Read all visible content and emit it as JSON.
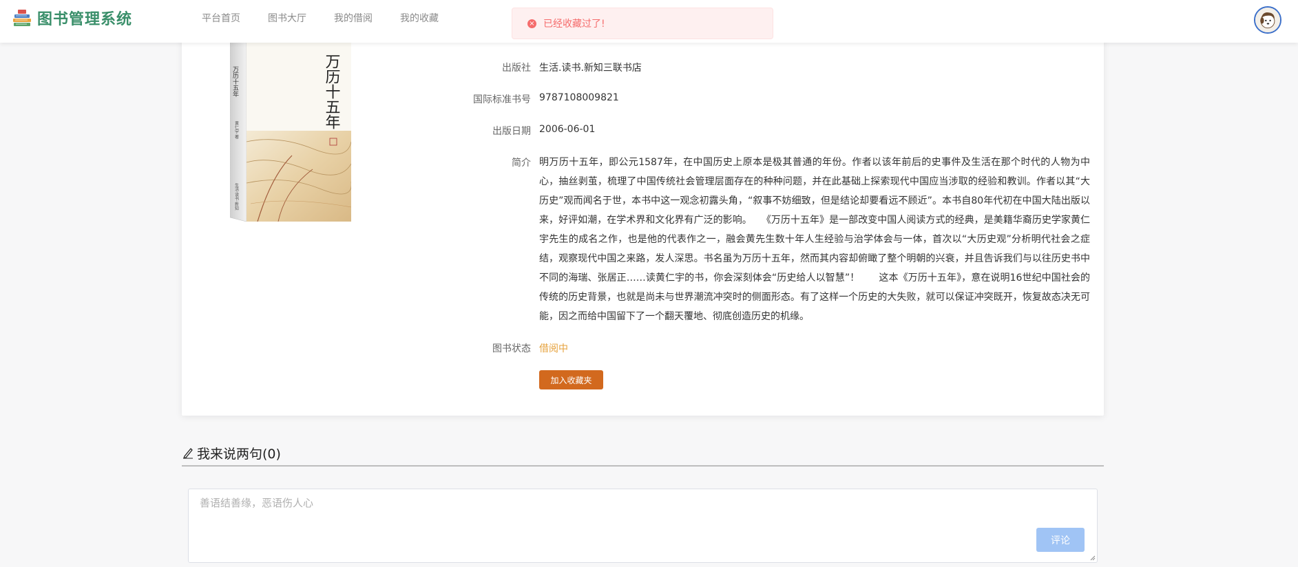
{
  "app": {
    "title": "图书管理系统"
  },
  "nav": {
    "items": [
      {
        "label": "平台首页"
      },
      {
        "label": "图书大厅"
      },
      {
        "label": "我的借阅"
      },
      {
        "label": "我的收藏"
      }
    ]
  },
  "toast": {
    "message": "已经收藏过了!",
    "icon": "error-circle-icon",
    "color": "#f56c6c"
  },
  "book": {
    "cover_title": "万历十五年",
    "fields": [
      {
        "label": "出版社",
        "value": "生活.读书.新知三联书店"
      },
      {
        "label": "国际标准书号",
        "value": "9787108009821"
      },
      {
        "label": "出版日期",
        "value": "2006-06-01"
      }
    ],
    "intro_label": "简介",
    "intro": "明万历十五年，即公元1587年，在中国历史上原本是极其普通的年份。作者以该年前后的史事件及生活在那个时代的人物为中心，抽丝剥茧，梳理了中国传统社会管理层面存在的种种问题，并在此基础上探索现代中国应当涉取的经验和教训。作者以其“大历史”观而闻名于世，本书中这一观念初露头角，“叙事不妨细致，但是结论却要看远不顾近”。本书自80年代初在中国大陆出版以来，好评如潮，在学术界和文化界有广泛的影响。　　《万历十五年》是一部改变中国人阅读方式的经典，是美籍华裔历史学家黄仁宇先生的成名之作，也是他的代表作之一，融会黄先生数十年人生经验与治学体会与一体，首次以“大历史观”分析明代社会之症结，观察现代中国之来路，发人深思。书名虽为万历十五年，然而其内容却俯瞰了整个明朝的兴衰，并且告诉我们与以往历史书中不同的海瑞、张居正……读黄仁宇的书，你会深刻体会“历史给人以智慧”！　　这本《万历十五年》，意在说明16世纪中国社会的传统的历史背景，也就是尚未与世界潮流冲突时的侧面形态。有了这样一个历史的大失败，就可以保证冲突既开，恢复故态决无可能，因之而给中国留下了一个翻天覆地、彻底创造历史的机缘。",
    "status_label": "图书状态",
    "status_value": "借阅中",
    "status_color": "#e6a23c",
    "favorite_button": "加入收藏夹"
  },
  "comments": {
    "title": "我来说两句(0)",
    "placeholder": "善语结善缘，恶语伤人心",
    "submit": "评论"
  },
  "colors": {
    "brand": "#3a8f6a",
    "favorite_button": "#d2691e",
    "submit_button": "#a0c4f5"
  }
}
